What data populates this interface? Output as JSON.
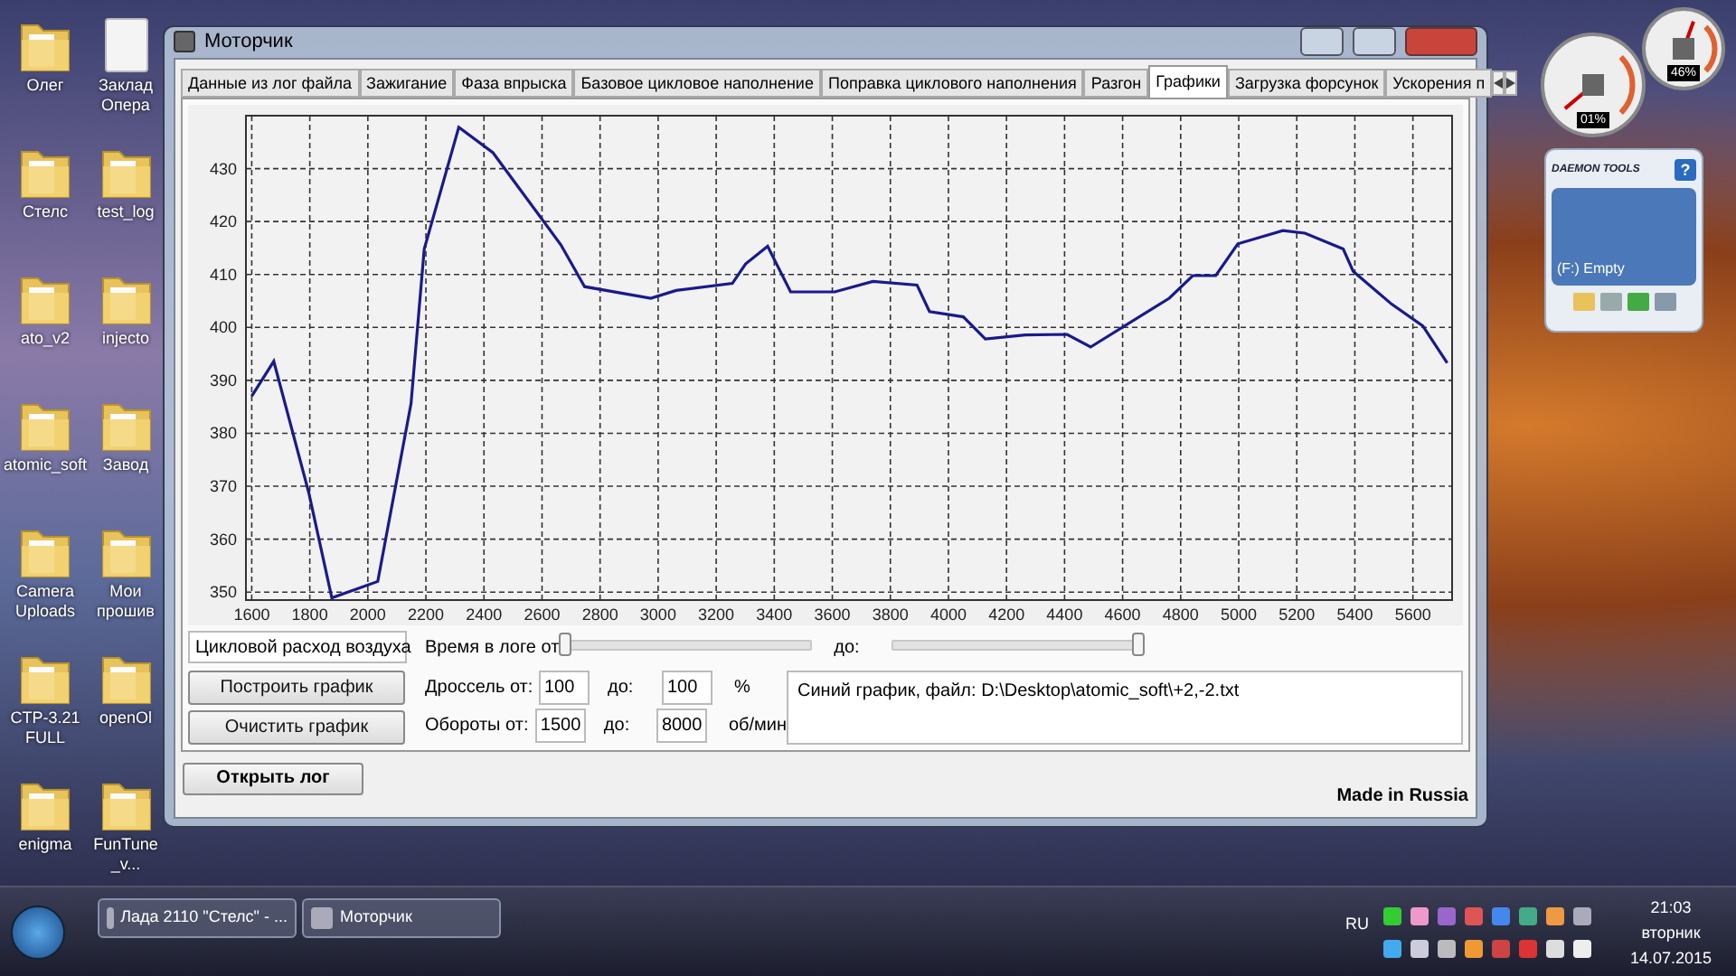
{
  "desktop_icon_columns": [
    [
      {
        "label": "Олег",
        "kind": "folder"
      },
      {
        "label": "Стелс",
        "kind": "folder"
      },
      {
        "label": "ato_v2",
        "kind": "folder"
      },
      {
        "label": "atomic_soft",
        "kind": "folder"
      },
      {
        "label": "Camera Uploads",
        "kind": "folder"
      },
      {
        "label": "CTP-3.21 FULL",
        "kind": "folder"
      },
      {
        "label": "enigma",
        "kind": "folder"
      }
    ],
    [
      {
        "label": "Заклад Опера",
        "kind": "file"
      },
      {
        "label": "test_log",
        "kind": "folder"
      },
      {
        "label": "injecto",
        "kind": "folder"
      },
      {
        "label": "Завод",
        "kind": "folder"
      },
      {
        "label": "Мои прошив",
        "kind": "folder"
      },
      {
        "label": "openOl",
        "kind": "folder"
      },
      {
        "label": "FunTune_v...",
        "kind": "folder"
      }
    ]
  ],
  "window": {
    "title": "Моторчик",
    "tabs": [
      {
        "label": "Данные из лог файла",
        "selected": false
      },
      {
        "label": "Зажигание",
        "selected": false
      },
      {
        "label": "Фаза впрыска",
        "selected": false
      },
      {
        "label": "Базовое цикловое наполнение",
        "selected": false
      },
      {
        "label": "Поправка циклового наполнения",
        "selected": false
      },
      {
        "label": "Разгон",
        "selected": false
      },
      {
        "label": "Графики",
        "selected": true
      },
      {
        "label": "Загрузка форсунок",
        "selected": false
      },
      {
        "label": "Ускорения п",
        "selected": false
      }
    ],
    "chart_data": {
      "type": "line",
      "grid": true,
      "x": [
        1600,
        1676,
        1797,
        1876,
        2034,
        2149,
        2194,
        2313,
        2431,
        2665,
        2747,
        2975,
        3062,
        3256,
        3301,
        3377,
        3456,
        3608,
        3740,
        3892,
        3935,
        4051,
        4127,
        4265,
        4409,
        4490,
        4761,
        4842,
        4921,
        4997,
        5152,
        5228,
        5360,
        5394,
        5527,
        5634,
        5718
      ],
      "series": [
        {
          "color": "#1a1a8c",
          "values": [
            387,
            393.6,
            368.7,
            348.9,
            352,
            385.6,
            414.8,
            437.8,
            433,
            415.6,
            407.7,
            405.5,
            407,
            408.3,
            412,
            415.3,
            406.7,
            406.7,
            408.7,
            408,
            403,
            402,
            397.8,
            398.6,
            398.7,
            396.3,
            405.5,
            409.8,
            409.8,
            415.8,
            418.3,
            417.8,
            414.8,
            410.6,
            404.4,
            400.3,
            393.3
          ]
        }
      ],
      "xlim": [
        1580,
        5735
      ],
      "ylim": [
        348.5,
        440
      ],
      "xticks": [
        1600,
        1800,
        2000,
        2200,
        2400,
        2600,
        2800,
        3000,
        3200,
        3400,
        3600,
        3800,
        4000,
        4200,
        4400,
        4600,
        4800,
        5000,
        5200,
        5400,
        5600
      ],
      "yticks": [
        350,
        360,
        370,
        380,
        390,
        400,
        410,
        420,
        430
      ]
    },
    "parameter_select": "Цикловой расход воздуха",
    "time_label": "Время в логе от",
    "time_from": {
      "level": 0
    },
    "time_to_label": "до:",
    "time_to": {
      "level": 1
    },
    "build_button": "Построить график",
    "clear_button": "Очистить график",
    "ranges": [
      {
        "label": "Дроссель от:",
        "from": "100",
        "to_label": "до:",
        "to": "100",
        "unit": "%"
      },
      {
        "label": "Обороты от:",
        "from": "1500",
        "to_label": "до:",
        "to": "8000",
        "unit": "об/мин"
      }
    ],
    "info_text": "Синий график, файл: D:\\Desktop\\atomic_soft\\+2,-2.txt",
    "open_log_button": "Открыть лог",
    "footer": "Made in Russia"
  },
  "gauges": [
    {
      "reading": "01%"
    },
    {
      "reading": "46%"
    }
  ],
  "daemon_tools": {
    "title": "DAEMON TOOLS",
    "help": "?",
    "drive": "(F:) Empty"
  },
  "taskbar": {
    "buttons": [
      {
        "label": "Лада 2110 \"Стелс\" - ..."
      },
      {
        "label": "Моторчик"
      }
    ],
    "language": "RU",
    "time": "21:03",
    "day": "вторник",
    "date": "14.07.2015"
  }
}
